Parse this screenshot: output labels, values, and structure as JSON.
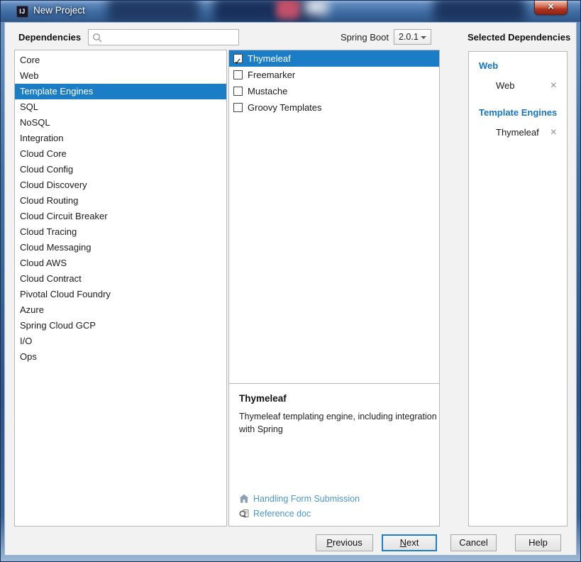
{
  "window": {
    "title": "New Project",
    "app_icon_text": "IJ",
    "close_glyph": "×"
  },
  "toolbar": {
    "dependencies_label": "Dependencies",
    "search": {
      "value": "",
      "icon": "search-icon"
    },
    "spring_boot_label": "Spring Boot",
    "spring_boot_version": "2.0.1",
    "selected_dependencies_label": "Selected Dependencies"
  },
  "categories": {
    "selected": "Template Engines",
    "items": [
      "Core",
      "Web",
      "Template Engines",
      "SQL",
      "NoSQL",
      "Integration",
      "Cloud Core",
      "Cloud Config",
      "Cloud Discovery",
      "Cloud Routing",
      "Cloud Circuit Breaker",
      "Cloud Tracing",
      "Cloud Messaging",
      "Cloud AWS",
      "Cloud Contract",
      "Pivotal Cloud Foundry",
      "Azure",
      "Spring Cloud GCP",
      "I/O",
      "Ops"
    ]
  },
  "dependencies": {
    "items": [
      {
        "label": "Thymeleaf",
        "checked": true,
        "selected": true
      },
      {
        "label": "Freemarker",
        "checked": false,
        "selected": false
      },
      {
        "label": "Mustache",
        "checked": false,
        "selected": false
      },
      {
        "label": "Groovy Templates",
        "checked": false,
        "selected": false
      }
    ]
  },
  "details": {
    "title": "Thymeleaf",
    "description": "Thymeleaf templating engine, including integration with Spring",
    "links": [
      {
        "label": "Handling Form Submission",
        "icon": "home-icon"
      },
      {
        "label": "Reference doc",
        "icon": "reference-doc-icon"
      }
    ]
  },
  "selected_dependencies": {
    "groups": [
      {
        "name": "Web",
        "items": [
          {
            "label": "Web",
            "remove_glyph": "×"
          }
        ]
      },
      {
        "name": "Template Engines",
        "items": [
          {
            "label": "Thymeleaf",
            "remove_glyph": "×"
          }
        ]
      }
    ]
  },
  "footer": {
    "previous": "Previous",
    "next": "Next",
    "cancel": "Cancel",
    "help": "Help"
  },
  "colors": {
    "selection_blue": "#1a7dc5",
    "group_header_blue": "#1576c0",
    "link_blue": "#4a97d0",
    "focus_border": "#1e7fc6",
    "close_button_red": "#b03522"
  }
}
